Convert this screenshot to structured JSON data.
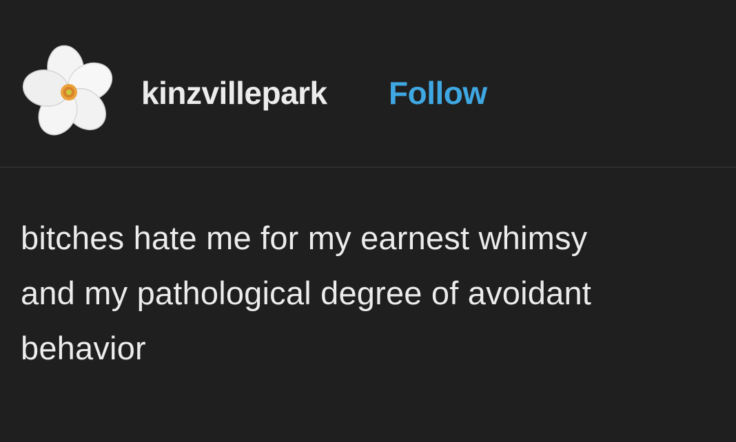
{
  "post": {
    "author": {
      "username": "kinzvillepark",
      "follow_label": "Follow",
      "avatar_icon": "white-flower-icon"
    },
    "body_lines": [
      "bitches hate me for my earnest whimsy",
      "and my pathological degree of avoidant",
      "behavior"
    ]
  },
  "colors": {
    "background": "#1f1f1f",
    "text": "#ececec",
    "follow_accent": "#3fa7e2",
    "divider": "#2e2e2e"
  }
}
